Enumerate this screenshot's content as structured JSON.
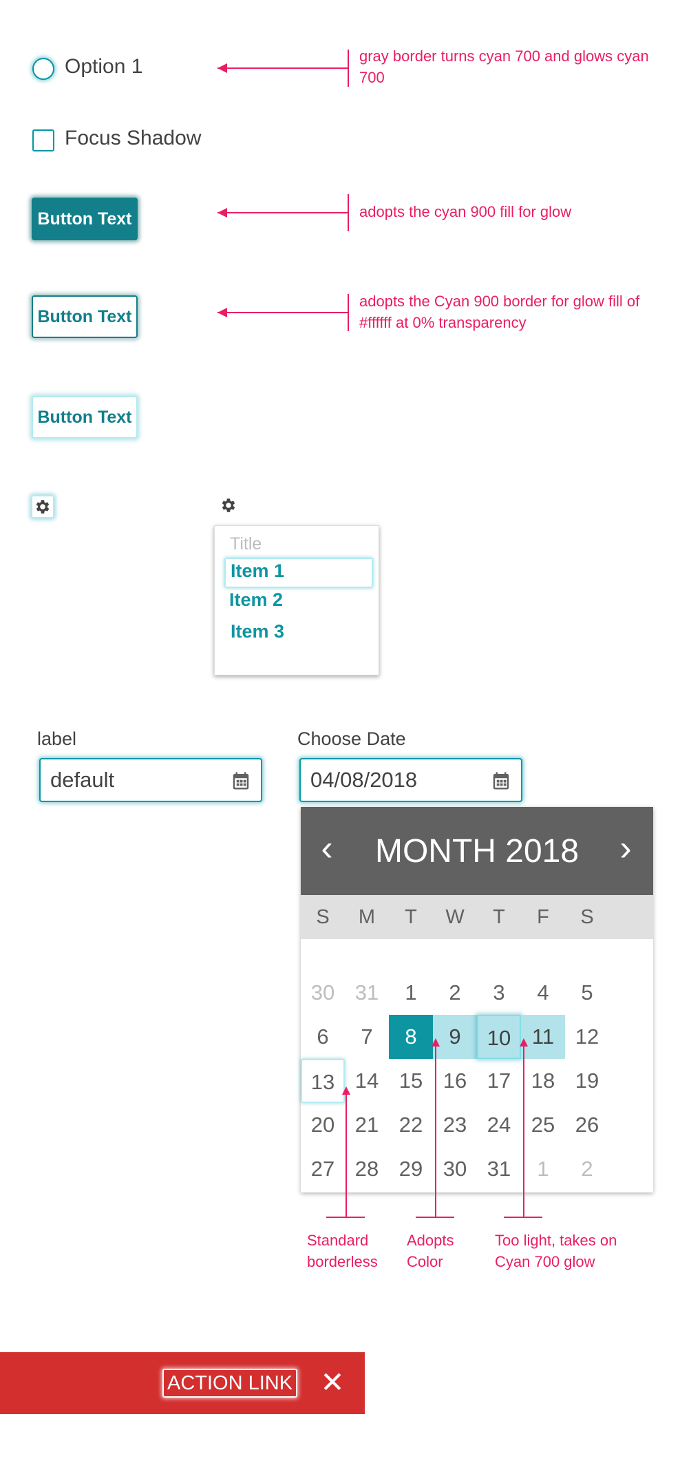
{
  "radio": {
    "label": "Option 1"
  },
  "checkbox": {
    "label": "Focus Shadow"
  },
  "buttons": {
    "filled": "Button Text",
    "outlined": "Button Text",
    "light": "Button Text"
  },
  "dropdown": {
    "title": "Title",
    "items": [
      "Item 1",
      "Item 2",
      "Item 3"
    ]
  },
  "fields": {
    "left": {
      "label": "label",
      "value": "default"
    },
    "right": {
      "label": "Choose Date",
      "value": "04/08/2018"
    }
  },
  "calendar": {
    "title": "MONTH 2018",
    "prev": "‹",
    "next": "›",
    "dow": [
      "S",
      "M",
      "T",
      "W",
      "T",
      "F",
      "S"
    ],
    "weeks": [
      [
        "30",
        "31",
        "1",
        "2",
        "3",
        "4",
        "5"
      ],
      [
        "6",
        "7",
        "8",
        "9",
        "10",
        "11",
        "12"
      ],
      [
        "13",
        "14",
        "15",
        "16",
        "17",
        "18",
        "19"
      ],
      [
        "20",
        "21",
        "22",
        "23",
        "24",
        "25",
        "26"
      ],
      [
        "27",
        "28",
        "29",
        "30",
        "31",
        "1",
        "2"
      ]
    ]
  },
  "annotations": {
    "radio": "gray border turns cyan 700 and glows cyan 700",
    "filled_button": "adopts the cyan 900 fill for glow",
    "outlined_button": "adopts the Cyan 900 border for glow fill of #ffffff at 0% transparency",
    "standard": "Standard borderless",
    "adopts": "Adopts Color",
    "too_light": "Too light, takes on Cyan 700 glow"
  },
  "snackbar": {
    "action": "ACTION LINK",
    "close": "✕"
  },
  "colors": {
    "cyan_700": "#0097a7",
    "cyan_900": "#006064",
    "accent_teal": "#127f8a",
    "annotation_pink": "#e91e63",
    "snackbar_red": "#d32f2f",
    "calendar_header": "#616161",
    "range_fill": "#b2e2ea"
  }
}
